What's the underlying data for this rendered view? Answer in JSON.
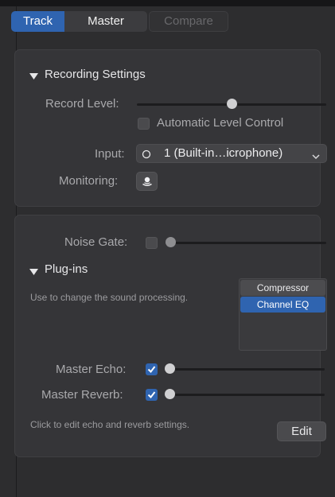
{
  "tabs": {
    "track": "Track",
    "master": "Master",
    "compare": "Compare"
  },
  "recording": {
    "title": "Recording Settings",
    "record_level_label": "Record Level:",
    "record_level_value": 0.5,
    "auto_level_label": "Automatic Level Control",
    "auto_level_checked": false,
    "input_label": "Input:",
    "input_value": "1 (Built-in…icrophone)",
    "monitoring_label": "Monitoring:"
  },
  "master": {
    "noise_gate_label": "Noise Gate:",
    "noise_gate_checked": false,
    "plugins_title": "Plug-ins",
    "plugins_description": "Use to change the sound processing.",
    "plugins": [
      "Compressor",
      "Channel EQ"
    ],
    "selected_plugin": "Channel EQ",
    "master_echo_label": "Master Echo:",
    "master_echo_checked": true,
    "master_reverb_label": "Master Reverb:",
    "master_reverb_checked": true,
    "edit_note": "Click to edit echo and reverb settings.",
    "edit_button": "Edit"
  },
  "colors": {
    "accent": "#2f64b0",
    "background": "#2d2d2f",
    "panel": "#353538"
  },
  "icons": [
    "disclosure-triangle-icon",
    "mono-input-icon",
    "chevron-down-icon",
    "monitoring-icon",
    "checkmark-icon"
  ]
}
